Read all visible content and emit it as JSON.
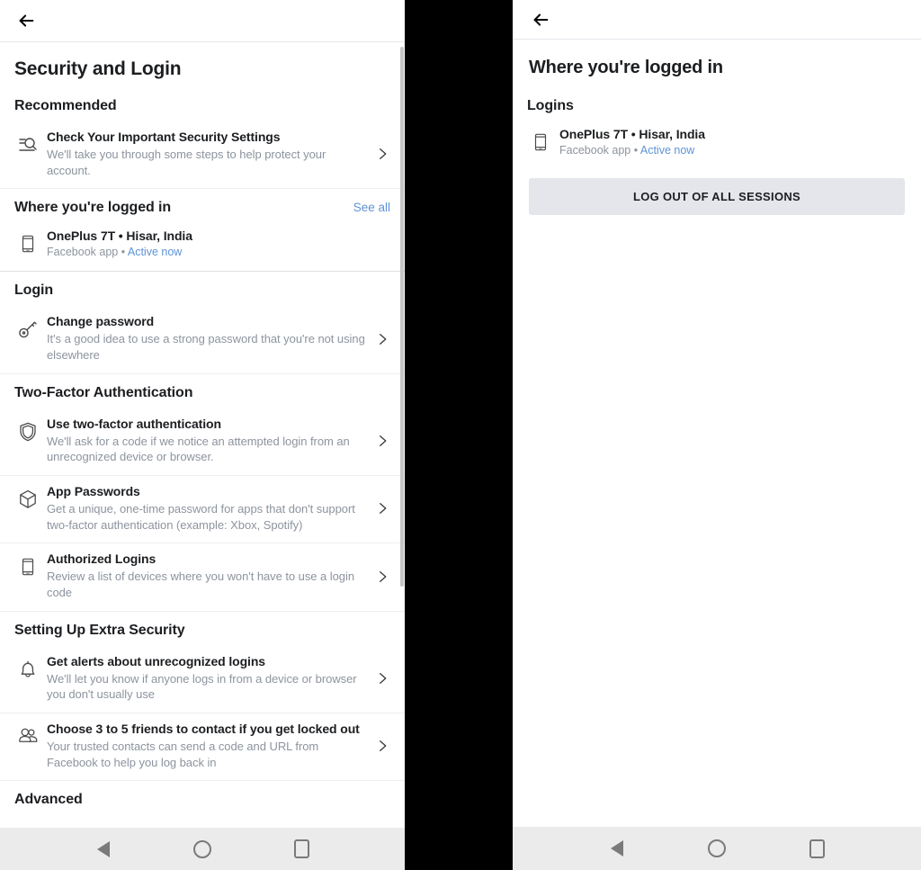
{
  "left_screen": {
    "appbar": {
      "back_icon": "back-arrow-icon"
    },
    "page_title": "Security and Login",
    "sections": [
      {
        "title": "Recommended",
        "see_all": null,
        "rows": [
          {
            "icon": "security-checkup-icon",
            "title": "Check Your Important Security Settings",
            "subtitle": "We'll take you through some steps to help protect your account.",
            "chevron": "chevron-right-icon"
          }
        ]
      },
      {
        "title": "Where you're logged in",
        "see_all": "See all",
        "device": {
          "icon": "mobile-device-icon",
          "name": "OnePlus 7T • Hisar, India",
          "meta_app": "Facebook app",
          "meta_separator": " • ",
          "meta_status": "Active now"
        }
      },
      {
        "title": "Login",
        "see_all": null,
        "rows": [
          {
            "icon": "key-icon",
            "title": "Change password",
            "subtitle": "It's a good idea to use a strong password that you're not using elsewhere",
            "chevron": "chevron-right-icon"
          }
        ]
      },
      {
        "title": "Two-Factor Authentication",
        "see_all": null,
        "rows": [
          {
            "icon": "shield-icon",
            "title": "Use two-factor authentication",
            "subtitle": "We'll ask for a code if we notice an attempted login from an unrecognized device or browser.",
            "chevron": "chevron-right-icon"
          },
          {
            "icon": "cube-icon",
            "title": "App Passwords",
            "subtitle": "Get a unique, one-time password for apps that don't support two-factor authentication (example: Xbox, Spotify)",
            "chevron": "chevron-right-icon"
          },
          {
            "icon": "mobile-device-icon",
            "title": "Authorized Logins",
            "subtitle": "Review a list of devices where you won't have to use a login code",
            "chevron": "chevron-right-icon"
          }
        ]
      },
      {
        "title": "Setting Up Extra Security",
        "see_all": null,
        "rows": [
          {
            "icon": "bell-icon",
            "title": "Get alerts about unrecognized logins",
            "subtitle": "We'll let you know if anyone logs in from a device or browser you don't usually use",
            "chevron": "chevron-right-icon"
          },
          {
            "icon": "friends-icon",
            "title": "Choose 3 to 5 friends to contact if you get locked out",
            "subtitle": "Your trusted contacts can send a code and URL from Facebook to help you log back in",
            "chevron": "chevron-right-icon"
          }
        ]
      },
      {
        "title": "Advanced",
        "see_all": null,
        "rows": []
      }
    ],
    "navbar": {
      "back": "nav-back-icon",
      "home": "nav-home-icon",
      "recents": "nav-recents-icon"
    }
  },
  "right_screen": {
    "appbar": {
      "back_icon": "back-arrow-icon"
    },
    "page_title": "Where you're logged in",
    "section_title": "Logins",
    "device": {
      "icon": "mobile-device-icon",
      "name": "OnePlus 7T • Hisar, India",
      "meta_app": "Facebook app",
      "meta_separator": " • ",
      "meta_status": "Active now"
    },
    "logout_button": "LOG OUT OF ALL SESSIONS",
    "navbar": {
      "back": "nav-back-icon",
      "home": "nav-home-icon",
      "recents": "nav-recents-icon"
    }
  },
  "colors": {
    "link_blue": "#5e93d6",
    "text_primary": "#1c1e21",
    "text_secondary": "#8d949e",
    "button_bg": "#e4e6eb",
    "navbar_bg": "#ebebeb",
    "gap_black": "#000000"
  }
}
